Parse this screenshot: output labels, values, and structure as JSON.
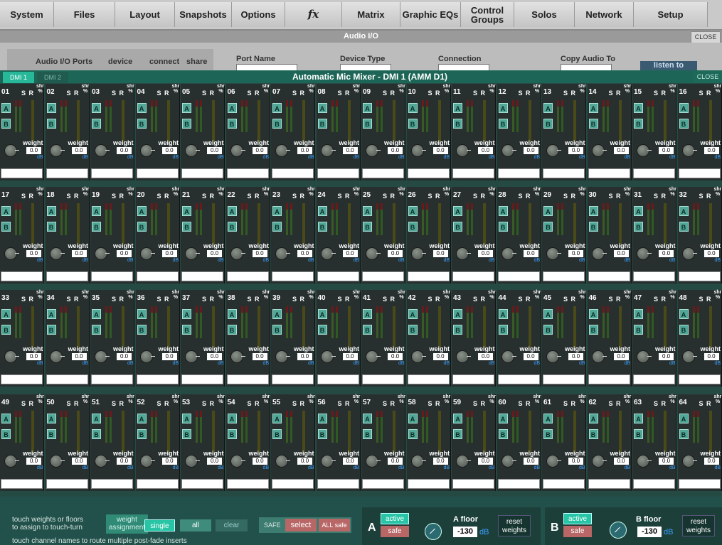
{
  "menu": [
    {
      "label": "System",
      "w": 76
    },
    {
      "label": "Files",
      "w": 86
    },
    {
      "label": "Layout",
      "w": 84
    },
    {
      "label": "Snapshots",
      "w": 80
    },
    {
      "label": "Options",
      "w": 75
    },
    {
      "label": "fx",
      "w": 80,
      "fx": true
    },
    {
      "label": "Matrix",
      "w": 82
    },
    {
      "label": "Graphic EQs",
      "w": 85
    },
    {
      "label": "Control\nGroups",
      "w": 75
    },
    {
      "label": "Solos",
      "w": 85
    },
    {
      "label": "Network",
      "w": 83
    },
    {
      "label": "Setup",
      "w": 104
    }
  ],
  "audio_io": {
    "title": "Audio I/O",
    "close": "CLOSE",
    "tab_label": "Audio I/O Ports",
    "tab_device": "device",
    "tab_connect": "connect",
    "tab_share": "share",
    "col_port": "Port Name",
    "col_device": "Device Type",
    "col_connection": "Connection",
    "col_copy": "Copy Audio To",
    "listen_label": "listen to"
  },
  "mixer": {
    "tabs": [
      "DMI 1",
      "DMI 2"
    ],
    "title": "Automatic Mic Mixer - DMI 1 (AMM D1)",
    "close": "CLOSE",
    "strip_labels": {
      "sr": "S R",
      "shr": "shr\n%",
      "a": "A",
      "b": "B",
      "weight": "weight",
      "value": "0.0",
      "unit": "dB"
    },
    "channels": [
      "01",
      "02",
      "03",
      "04",
      "05",
      "06",
      "07",
      "08",
      "09",
      "10",
      "11",
      "12",
      "13",
      "14",
      "15",
      "16",
      "17",
      "18",
      "19",
      "20",
      "21",
      "22",
      "23",
      "24",
      "25",
      "26",
      "27",
      "28",
      "29",
      "30",
      "31",
      "32",
      "33",
      "34",
      "35",
      "36",
      "37",
      "38",
      "39",
      "40",
      "41",
      "42",
      "43",
      "44",
      "45",
      "46",
      "47",
      "48",
      "49",
      "50",
      "51",
      "52",
      "53",
      "54",
      "55",
      "56",
      "57",
      "58",
      "59",
      "60",
      "61",
      "62",
      "63",
      "64"
    ]
  },
  "bottom": {
    "hint1": "touch weights or floors",
    "hint2": "to assign to touch-turn",
    "hint3": "touch channel names to route multiple post-fade inserts",
    "weight_assign_1": "weight",
    "weight_assign_2": "assignment",
    "single": "single",
    "all": "all",
    "clear": "clear",
    "safe_label": "SAFE",
    "select": "select",
    "all_safe": "ALL safe",
    "group_a": {
      "letter": "A",
      "active": "active",
      "safe": "safe",
      "floor_label": "A floor",
      "floor_value": "-130",
      "unit": "dB",
      "reset": "reset\nweights"
    },
    "group_b": {
      "letter": "B",
      "active": "active",
      "safe": "safe",
      "floor_label": "B floor",
      "floor_value": "-130",
      "unit": "dB",
      "reset": "reset\nweights"
    }
  },
  "colors": {
    "accent": "#27b89a",
    "panel": "#254a44",
    "strip": "#28302f"
  }
}
